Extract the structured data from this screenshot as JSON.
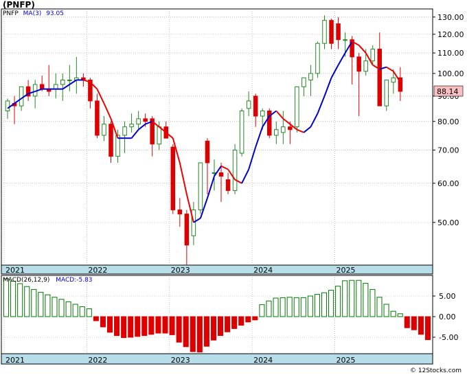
{
  "header": {
    "ticker": "(PNFP)",
    "symbol": "PNFP",
    "ma_label": "MA(3)",
    "ma_value": "93.05",
    "macd_label": "MACD(26,12,9)",
    "macd_value": "MACD:-5.83",
    "credit": "© 12Stocks.com"
  },
  "colors": {
    "up_candle": "#000000",
    "up_fill": "#ffffff",
    "down_candle": "#dd0000",
    "ma_up": "#0000cc",
    "ma_down": "#ee0000",
    "macd_pos": "#007700",
    "macd_neg": "#dd0000",
    "axis_band": "#b7dde8",
    "last_price_bg": "#f8c0c0"
  },
  "chart_data": [
    {
      "type": "candlestick",
      "title": "(PNFP)",
      "x_ticks": [
        "2021",
        "2022",
        "2023",
        "2024",
        "2025"
      ],
      "y_ticks": [
        50,
        60,
        70,
        80,
        90,
        100,
        110,
        120,
        130
      ],
      "y_tick_labels": [
        "50.00",
        "60.00",
        "70.00",
        "80.00",
        "90.00",
        "100.00",
        "110.00",
        "120.00",
        "130.00"
      ],
      "y_scale": "log",
      "ylim": [
        41,
        135
      ],
      "last_price_label": "88.14",
      "grid": true,
      "series": [
        {
          "name": "PNFP",
          "candles": [
            [
              84,
              89,
              81,
              88
            ],
            [
              87,
              90,
              79,
              86
            ],
            [
              86,
              93,
              84,
              94
            ],
            [
              94,
              97,
              88,
              90
            ],
            [
              90,
              97,
              85,
              95
            ],
            [
              95,
              99,
              92,
              93
            ],
            [
              93,
              104,
              90,
              92
            ],
            [
              93,
              100,
              89,
              95
            ],
            [
              95,
              100,
              88,
              97
            ],
            [
              97,
              104,
              92,
              97
            ],
            [
              97,
              108,
              91,
              98
            ],
            [
              98,
              100,
              94,
              97
            ],
            [
              97,
              98,
              85,
              88
            ],
            [
              88,
              91,
              74,
              75
            ],
            [
              75,
              82,
              73,
              79
            ],
            [
              79,
              80,
              66,
              68
            ],
            [
              68,
              77,
              66,
              75
            ],
            [
              75,
              80,
              69,
              78
            ],
            [
              78,
              83,
              76,
              79
            ],
            [
              79,
              84,
              77,
              81
            ],
            [
              81,
              83,
              78,
              80
            ],
            [
              81,
              82,
              68,
              72
            ],
            [
              72,
              80,
              70,
              78
            ],
            [
              78,
              80,
              74,
              74
            ],
            [
              71,
              72,
              52,
              53
            ],
            [
              53,
              56,
              49,
              52
            ],
            [
              52,
              53,
              41,
              45
            ],
            [
              47,
              55,
              45,
              53
            ],
            [
              53,
              66,
              52,
              66
            ],
            [
              73,
              74,
              57,
              66
            ],
            [
              63,
              67,
              58,
              63
            ],
            [
              63,
              66,
              55,
              62
            ],
            [
              61,
              63,
              57,
              58
            ],
            [
              58,
              72,
              57,
              70
            ],
            [
              69,
              85,
              68,
              84
            ],
            [
              85,
              92,
              82,
              88
            ],
            [
              90,
              91,
              78,
              82
            ],
            [
              82,
              85,
              77,
              84
            ],
            [
              84,
              85,
              74,
              75
            ],
            [
              75,
              80,
              72,
              77
            ],
            [
              76,
              84,
              72,
              78
            ],
            [
              78,
              80,
              72,
              77
            ],
            [
              78,
              94,
              76,
              94
            ],
            [
              94,
              98,
              90,
              98
            ],
            [
              97,
              104,
              90,
              100
            ],
            [
              100,
              116,
              98,
              115
            ],
            [
              115,
              131,
              112,
              128
            ],
            [
              128,
              129,
              112,
              115
            ],
            [
              126,
              130,
              112,
              117
            ],
            [
              117,
              121,
              108,
              117
            ],
            [
              117,
              119,
              95,
              108
            ],
            [
              108,
              110,
              82,
              101
            ],
            [
              101,
              112,
              99,
              106
            ],
            [
              106,
              114,
              104,
              112
            ],
            [
              112,
              121,
              87,
              86
            ],
            [
              86,
              97,
              84,
              97
            ],
            [
              96,
              102,
              91,
              98
            ],
            [
              98,
              103,
              88,
              92
            ]
          ],
          "ma3": [
            85,
            87,
            89,
            91,
            92,
            93,
            93,
            93,
            93,
            95,
            97,
            97,
            96,
            93,
            87,
            81,
            74,
            74,
            74,
            77,
            79,
            80,
            78,
            76,
            74,
            66,
            57,
            50,
            51,
            56,
            62,
            65,
            64,
            61,
            60,
            64,
            71,
            78,
            82,
            84,
            81,
            79,
            77,
            76,
            78,
            83,
            90,
            98,
            104,
            110,
            116,
            114,
            110,
            104,
            102,
            103,
            101,
            96,
            93,
            94
          ],
          "ma_highlight": "93.05"
        }
      ]
    },
    {
      "type": "bar",
      "title": "MACD(26,12,9)",
      "x_ticks": [
        "2021",
        "2022",
        "2023",
        "2024",
        "2025"
      ],
      "y_ticks": [
        -5,
        0,
        5
      ],
      "y_tick_labels": [
        "-5.00",
        "0.00",
        "5.00"
      ],
      "ylim": [
        -9,
        10
      ],
      "series": [
        {
          "name": "MACD",
          "values": [
            9.2,
            8.6,
            8.0,
            7.3,
            6.6,
            5.9,
            5.3,
            4.7,
            4.2,
            3.6,
            3.0,
            2.4,
            1.9,
            -1.0,
            -2.5,
            -3.8,
            -4.6,
            -5.1,
            -5.0,
            -4.8,
            -4.6,
            -4.3,
            -4.0,
            -4.0,
            -4.4,
            -6.2,
            -7.3,
            -8.5,
            -8.6,
            -7.2,
            -5.7,
            -4.6,
            -3.7,
            -2.9,
            -2.1,
            -1.3,
            -0.8,
            2.9,
            3.8,
            4.5,
            4.6,
            4.7,
            4.6,
            4.6,
            5.0,
            5.4,
            5.8,
            6.4,
            7.4,
            8.7,
            8.8,
            8.8,
            8.1,
            6.6,
            4.7,
            3.0,
            1.3,
            0.7,
            -2.7,
            -3.2,
            -4.3,
            -5.6
          ]
        }
      ]
    }
  ]
}
